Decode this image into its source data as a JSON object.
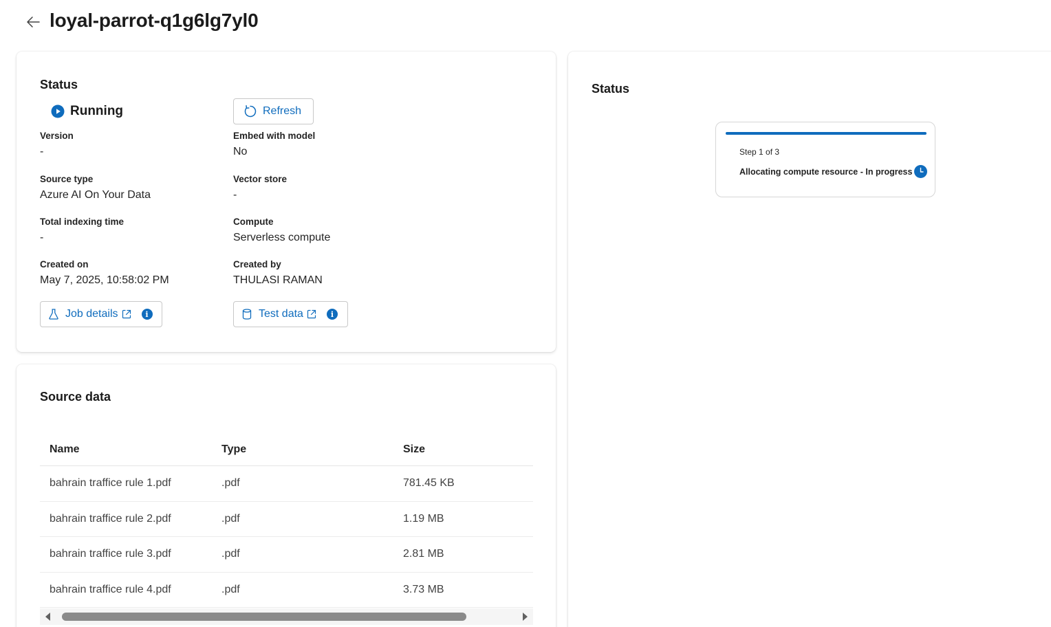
{
  "header": {
    "title": "loyal-parrot-q1g6lg7yl0",
    "back_icon": "arrow-left-icon"
  },
  "status_card": {
    "title": "Status",
    "state": "Running",
    "refresh_label": "Refresh",
    "fields": [
      {
        "label": "Version",
        "value": "-"
      },
      {
        "label": "Embed with model",
        "value": "No"
      },
      {
        "label": "Source type",
        "value": "Azure AI On Your Data"
      },
      {
        "label": "Vector store",
        "value": "-"
      },
      {
        "label": "Total indexing time",
        "value": "-"
      },
      {
        "label": "Compute",
        "value": "Serverless compute"
      },
      {
        "label": "Created on",
        "value": "May 7, 2025, 10:58:02 PM"
      },
      {
        "label": "Created by",
        "value": "THULASI RAMAN"
      }
    ],
    "job_details_label": "Job details",
    "test_data_label": "Test data",
    "info_glyph": "i"
  },
  "source_data": {
    "title": "Source data",
    "columns": [
      "Name",
      "Type",
      "Size"
    ],
    "rows": [
      {
        "name": "bahrain traffice rule 1.pdf",
        "type": ".pdf",
        "size": "781.45 KB"
      },
      {
        "name": "bahrain traffice rule 2.pdf",
        "type": ".pdf",
        "size": "1.19 MB"
      },
      {
        "name": "bahrain traffice rule 3.pdf",
        "type": ".pdf",
        "size": "2.81 MB"
      },
      {
        "name": "bahrain traffice rule 4.pdf",
        "type": ".pdf",
        "size": "3.73 MB"
      }
    ]
  },
  "right_panel": {
    "title": "Status",
    "step_count": "Step 1 of 3",
    "step_text": "Allocating compute resource - In progress"
  },
  "colors": {
    "accent": "#0f6cbd",
    "text": "#242424",
    "border": "#c8c8c8"
  }
}
